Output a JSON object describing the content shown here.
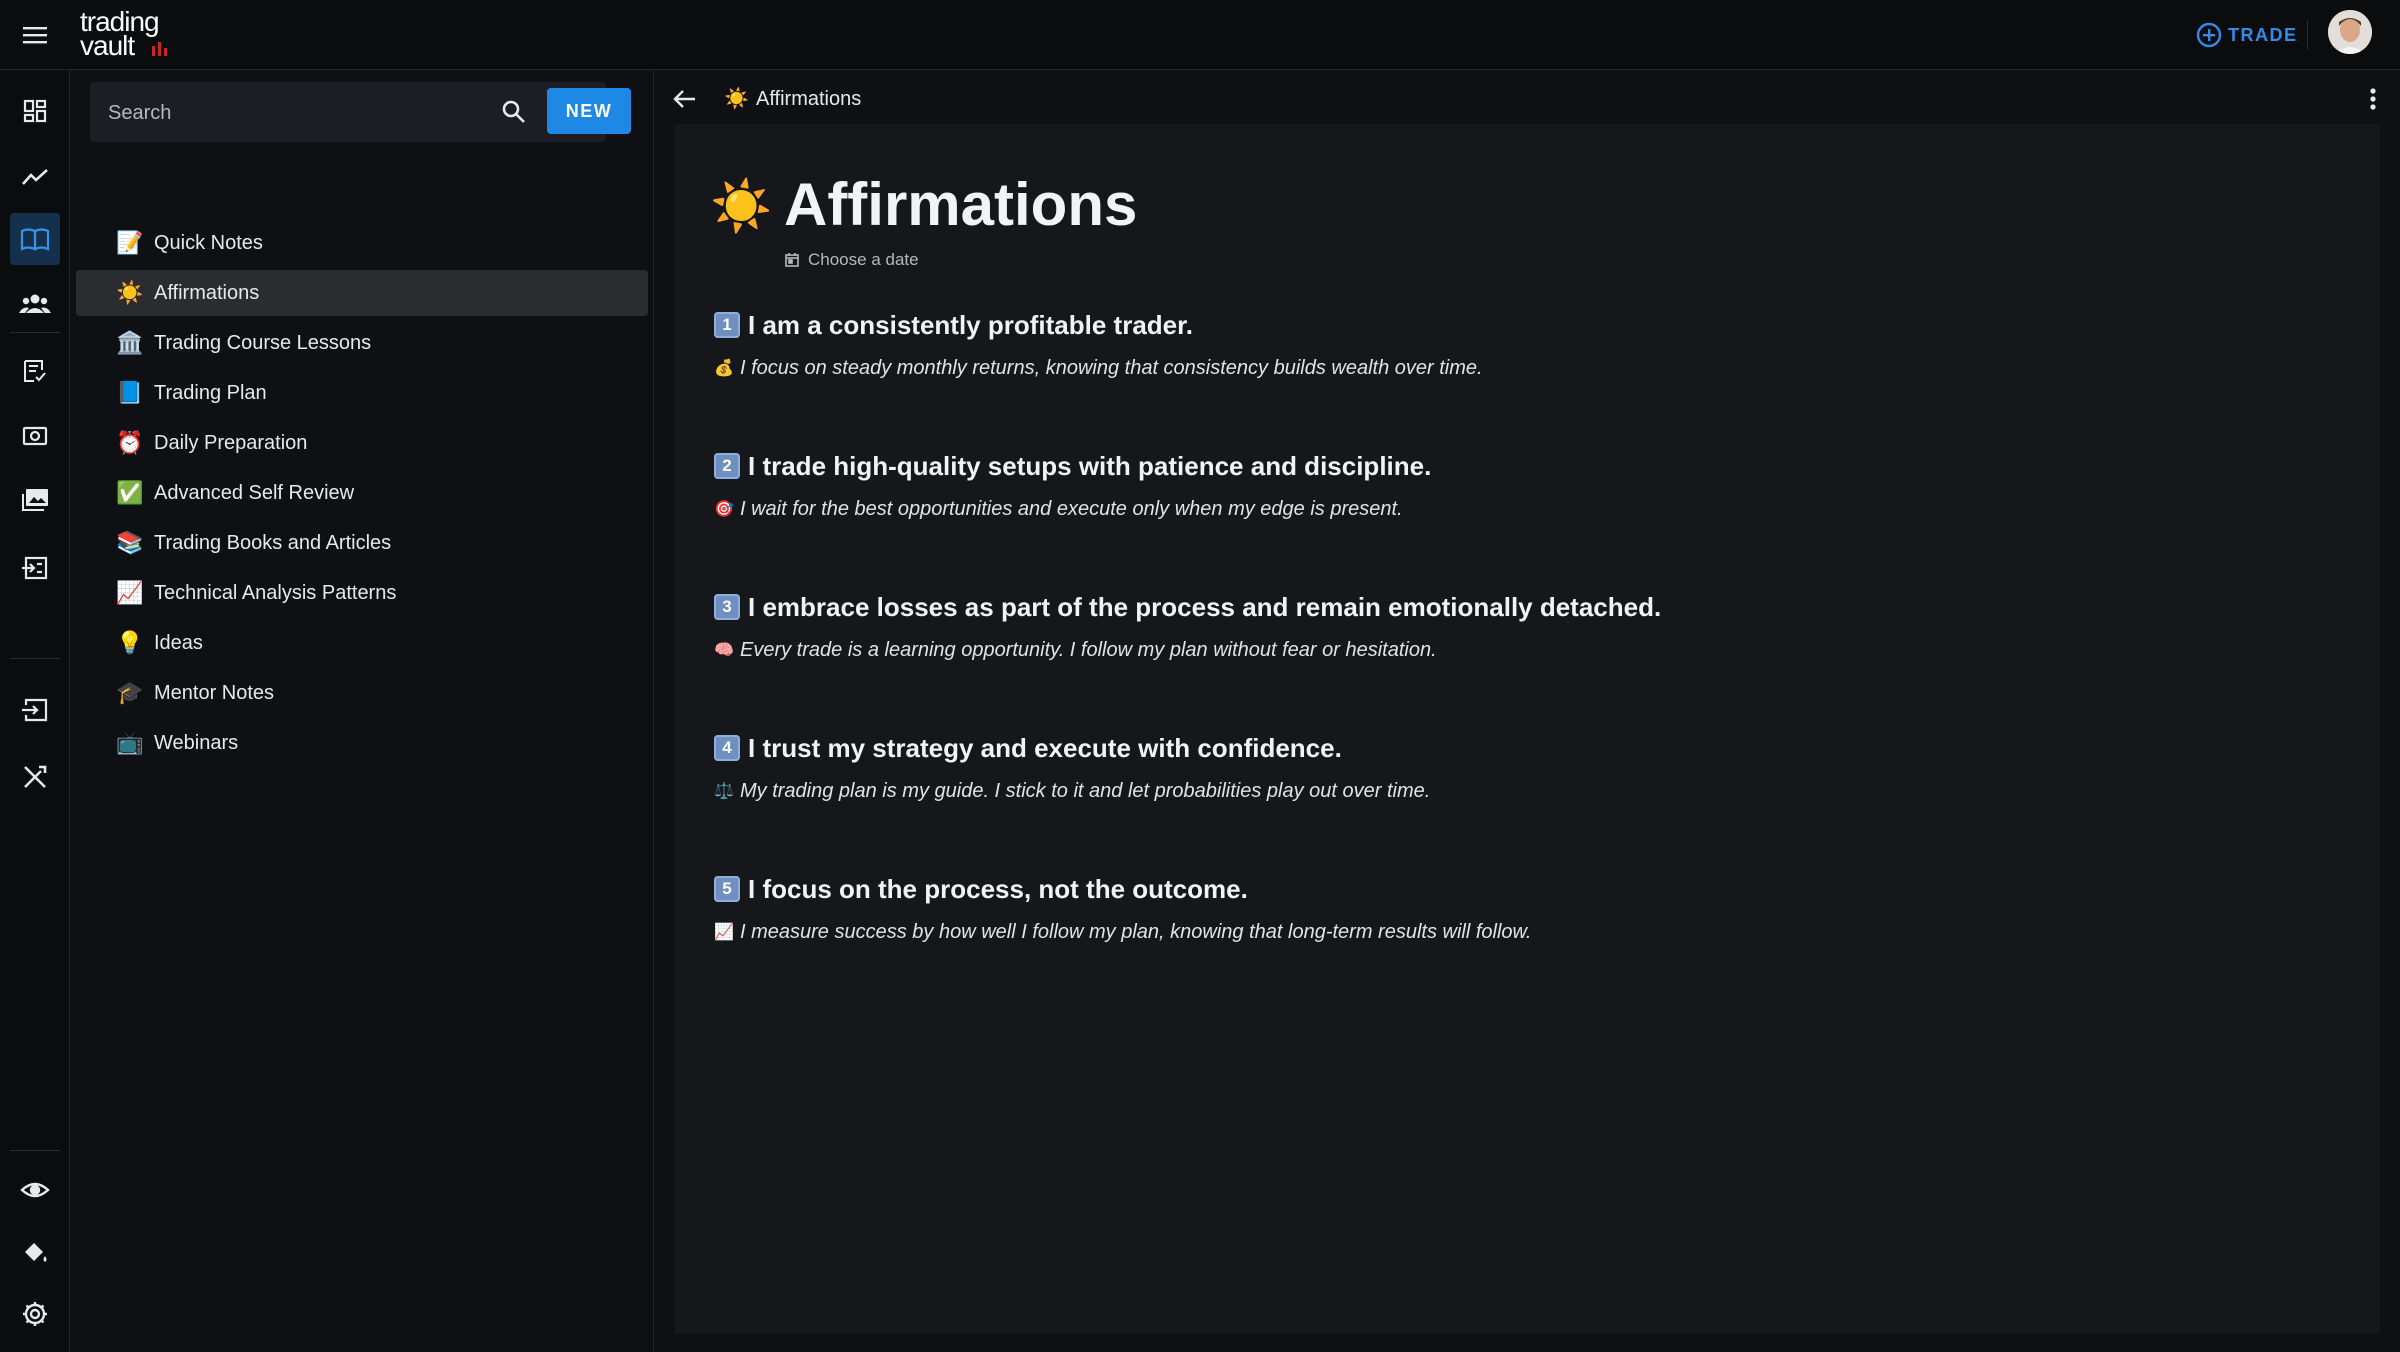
{
  "app": {
    "logo_line1": "trading",
    "logo_line2": "vault",
    "trade_label": "TRADE",
    "accent_color": "#1e88e5"
  },
  "rail": {
    "icons": [
      "dashboard-icon",
      "trend-icon",
      "book-icon",
      "groups-icon",
      "checklist-icon",
      "camera-icon",
      "gallery-icon",
      "import-icon",
      "login-icon",
      "tools-icon",
      "eye-icon",
      "paint-bucket-icon",
      "gear-icon"
    ],
    "active": "book-icon"
  },
  "sidebar": {
    "search_placeholder": "Search",
    "new_label": "NEW",
    "notes": [
      {
        "emoji": "📝",
        "label": "Quick Notes"
      },
      {
        "emoji": "☀️",
        "label": "Affirmations",
        "active": true
      },
      {
        "emoji": "🏛️",
        "label": "Trading Course Lessons"
      },
      {
        "emoji": "📘",
        "label": "Trading Plan"
      },
      {
        "emoji": "⏰",
        "label": "Daily Preparation"
      },
      {
        "emoji": "✅",
        "label": "Advanced Self Review"
      },
      {
        "emoji": "📚",
        "label": "Trading Books and Articles"
      },
      {
        "emoji": "📈",
        "label": "Technical Analysis Patterns"
      },
      {
        "emoji": "💡",
        "label": "Ideas"
      },
      {
        "emoji": "🎓",
        "label": "Mentor Notes"
      },
      {
        "emoji": "📺",
        "label": "Webinars"
      }
    ]
  },
  "main": {
    "breadcrumb_emoji": "☀️",
    "breadcrumb_title": "Affirmations",
    "page_emoji": "☀️",
    "page_title": "Affirmations",
    "date_label": "Choose a date",
    "affirmations": [
      {
        "num": "1",
        "title": "I am a consistently profitable trader.",
        "emoji": "💰",
        "text": "I focus on steady monthly returns, knowing that consistency builds wealth over time."
      },
      {
        "num": "2",
        "title": "I trade high-quality setups with patience and discipline.",
        "emoji": "🎯",
        "text": "I wait for the best opportunities and execute only when my edge is present."
      },
      {
        "num": "3",
        "title": "I embrace losses as part of the process and remain emotionally detached.",
        "emoji": "🧠",
        "text": "Every trade is a learning opportunity. I follow my plan without fear or hesitation."
      },
      {
        "num": "4",
        "title": "I trust my strategy and execute with confidence.",
        "emoji": "⚖️",
        "text": "My trading plan is my guide. I stick to it and let probabilities play out over time."
      },
      {
        "num": "5",
        "title": "I focus on the process, not the outcome.",
        "emoji": "📈",
        "text": "I measure success by how well I follow my plan, knowing that long-term results will follow."
      }
    ]
  }
}
